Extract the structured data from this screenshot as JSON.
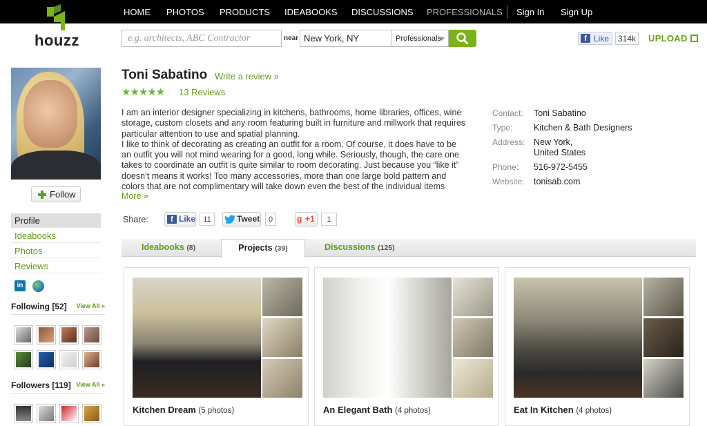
{
  "nav": {
    "items": [
      "HOME",
      "PHOTOS",
      "PRODUCTS",
      "IDEABOOKS",
      "DISCUSSIONS",
      "PROFESSIONALS"
    ],
    "sign_in": "Sign In",
    "sign_up": "Sign Up"
  },
  "header": {
    "logo_text": "houzz",
    "search_placeholder": "e.g. architects, ABC Contractor",
    "near_label": "near",
    "location_value": "New York, NY",
    "category_value": "Professionals",
    "fb_like_label": "Like",
    "fb_like_count": "314k",
    "upload_label": "UPLOAD"
  },
  "sidebar": {
    "follow_label": "Follow",
    "links": [
      "Profile",
      "Ideabooks",
      "Photos",
      "Reviews"
    ],
    "following_label": "Following",
    "following_count": "[52]",
    "followers_label": "Followers",
    "followers_count": "[119]",
    "view_all": "View All »",
    "linkedin_text": "in"
  },
  "profile": {
    "name": "Toni Sabatino",
    "write_review": "Write a review »",
    "stars": "★★★★★",
    "rating": 5,
    "reviews": "13 Reviews",
    "bio_1": "I am an interior designer specializing in kitchens, bathrooms, home libraries, offices, wine storage, custom closets and any room featuring built in furniture and millwork that requires particular attention to use and spatial planning.",
    "bio_2": "I like to think of decorating as creating an outfit for a room. Of course, it does have to be an outfit you will not mind wearing for a good, long while. Seriously, though, the care one takes to coordinate an outfit is quite similar to room decorating. Just because you “like it” doesn’t means it works! Too many accessories, more than one large bold pattern and colors that are not complimentary will take down even the best of the individual items being used. Cohesive",
    "more": "More »"
  },
  "contact": {
    "contact_label": "Contact:",
    "contact_value": "Toni Sabatino",
    "type_label": "Type:",
    "type_value": "Kitchen & Bath Designers",
    "address_label": "Address:",
    "address_line1": "New York,",
    "address_line2": "United States",
    "phone_label": "Phone:",
    "phone_value": "516-972-5455",
    "website_label": "Website:",
    "website_value": "tonisab.com"
  },
  "share": {
    "label": "Share:",
    "like_label": "Like",
    "like_count": "11",
    "tweet_label": "Tweet",
    "tweet_count": "0",
    "gplus_label": "+1",
    "gplus_count": "1"
  },
  "tabs": [
    {
      "label": "Ideabooks",
      "count": "(8)"
    },
    {
      "label": "Projects",
      "count": "(39)"
    },
    {
      "label": "Discussions",
      "count": "(125)"
    }
  ],
  "projects": [
    {
      "title": "Kitchen Dream",
      "count": "(5 photos)"
    },
    {
      "title": "An Elegant Bath",
      "count": "(4 photos)"
    },
    {
      "title": "Eat In Kitchen",
      "count": "(4 photos)"
    }
  ],
  "colors": {
    "brand_green": "#7ab317",
    "link_green": "#5e9a1b",
    "nav_bg": "#000000",
    "star_green": "#6db33f"
  }
}
